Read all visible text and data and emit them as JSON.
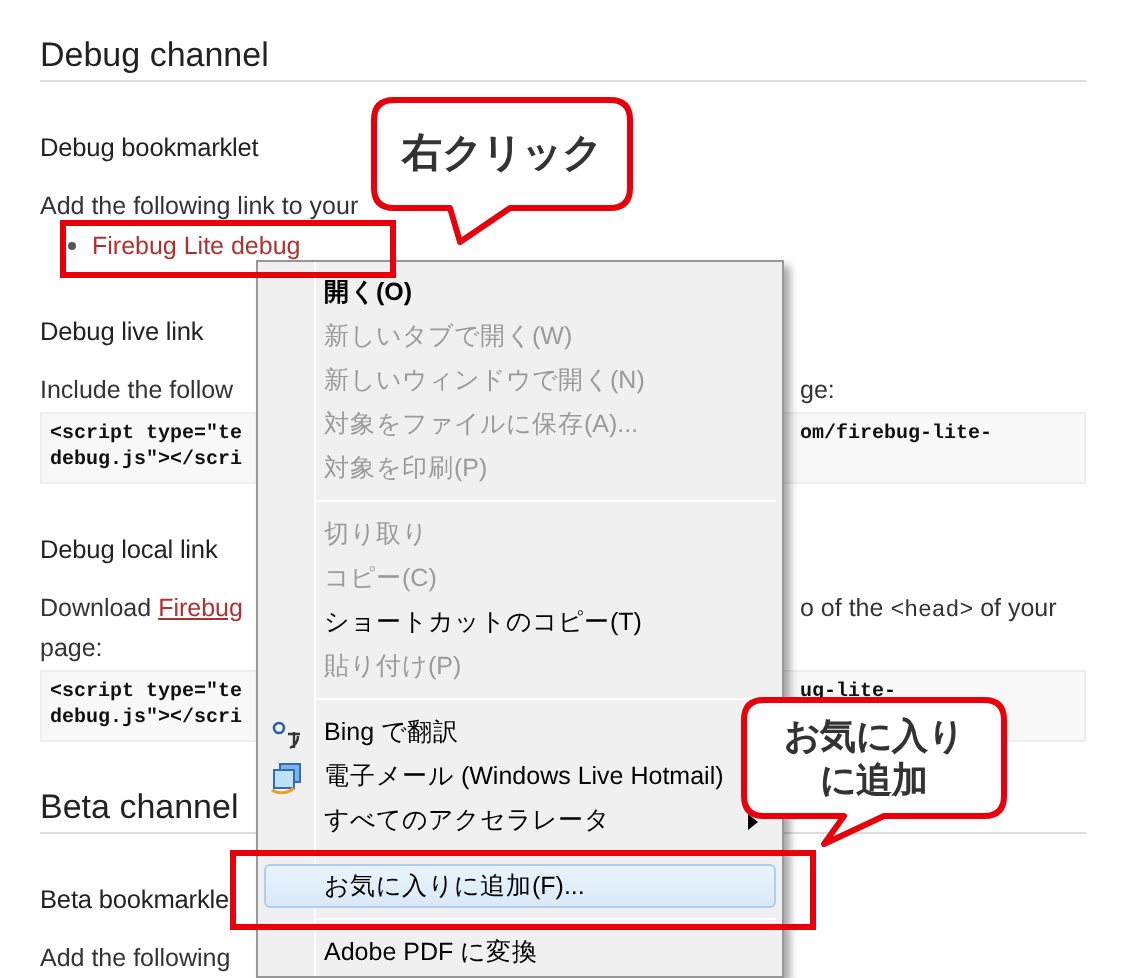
{
  "page": [
    {
      "kind": "heading",
      "text": "Debug channel"
    },
    {
      "kind": "subheading",
      "text": "Debug bookmarklet"
    },
    {
      "kind": "text",
      "lines": [
        [
          [
            {
              "kind": "plain",
              "text": "Add the following link to your"
            }
          ]
        ]
      ]
    },
    {
      "kind": "link_item",
      "text": "Firebug Lite debug"
    },
    {
      "kind": "subheading",
      "text": "Debug live link"
    },
    {
      "kind": "text",
      "lines": [
        [
          [
            {
              "kind": "plain",
              "text": "Include the follow"
            }
          ],
          [
            {
              "kind": "plain",
              "text": "ge:"
            }
          ]
        ]
      ]
    },
    {
      "kind": "code",
      "lines": [
        [
          "<script type=\"te",
          "om/firebug-lite-"
        ],
        [
          "debug.js\"></scri"
        ]
      ]
    },
    {
      "kind": "subheading",
      "text": "Debug local link"
    },
    {
      "kind": "text",
      "lines": [
        [
          [
            {
              "kind": "plain",
              "text": "Download "
            },
            {
              "kind": "link",
              "text": "Firebug"
            }
          ],
          [
            {
              "kind": "plain",
              "text": "o of the "
            },
            {
              "kind": "code",
              "text": "<head>"
            },
            {
              "kind": "plain",
              "text": " of your"
            }
          ]
        ],
        [
          [
            {
              "kind": "plain",
              "text": "page:"
            }
          ]
        ]
      ]
    },
    {
      "kind": "code",
      "lines": [
        [
          "<script type=\"te",
          "ug-lite-"
        ],
        [
          "debug.js\"></scri"
        ]
      ]
    },
    {
      "kind": "heading",
      "text": "Beta channel"
    },
    {
      "kind": "subheading",
      "text": "Beta bookmarkle"
    },
    {
      "kind": "text",
      "lines": [
        [
          [
            {
              "kind": "plain",
              "text": "Add the following"
            }
          ]
        ]
      ]
    }
  ],
  "context_menu": [
    {
      "kind": "item",
      "label": "開く(O)",
      "default": true,
      "disabled": false,
      "selected": false,
      "submenu": false
    },
    {
      "kind": "item",
      "label": "新しいタブで開く(W)",
      "default": false,
      "disabled": true,
      "selected": false,
      "submenu": false
    },
    {
      "kind": "item",
      "label": "新しいウィンドウで開く(N)",
      "default": false,
      "disabled": true,
      "selected": false,
      "submenu": false
    },
    {
      "kind": "item",
      "label": "対象をファイルに保存(A)...",
      "default": false,
      "disabled": true,
      "selected": false,
      "submenu": false
    },
    {
      "kind": "item",
      "label": "対象を印刷(P)",
      "default": false,
      "disabled": true,
      "selected": false,
      "submenu": false
    },
    {
      "kind": "separator"
    },
    {
      "kind": "item",
      "label": "切り取り",
      "default": false,
      "disabled": true,
      "selected": false,
      "submenu": false
    },
    {
      "kind": "item",
      "label": "コピー(C)",
      "default": false,
      "disabled": true,
      "selected": false,
      "submenu": false
    },
    {
      "kind": "item",
      "label": "ショートカットのコピー(T)",
      "default": false,
      "disabled": false,
      "selected": false,
      "submenu": false
    },
    {
      "kind": "item",
      "label": "貼り付け(P)",
      "default": false,
      "disabled": true,
      "selected": false,
      "submenu": false
    },
    {
      "kind": "separator"
    },
    {
      "kind": "item",
      "label": "Bing で翻訳",
      "default": false,
      "disabled": false,
      "selected": false,
      "submenu": false
    },
    {
      "kind": "item",
      "label": "電子メール (Windows Live Hotmail)",
      "default": false,
      "disabled": false,
      "selected": false,
      "submenu": false
    },
    {
      "kind": "item",
      "label": "すべてのアクセラレータ",
      "default": false,
      "disabled": false,
      "selected": false,
      "submenu": true
    },
    {
      "kind": "separator"
    },
    {
      "kind": "item",
      "label": "お気に入りに追加(F)...",
      "default": false,
      "disabled": false,
      "selected": true,
      "submenu": false
    },
    {
      "kind": "separator"
    },
    {
      "kind": "item",
      "label": "Adobe PDF に変換",
      "default": false,
      "disabled": false,
      "selected": false,
      "submenu": false
    }
  ],
  "callouts": [
    {
      "lines": [
        "右クリック"
      ]
    },
    {
      "lines": [
        "お気に入り",
        "に追加"
      ]
    }
  ]
}
